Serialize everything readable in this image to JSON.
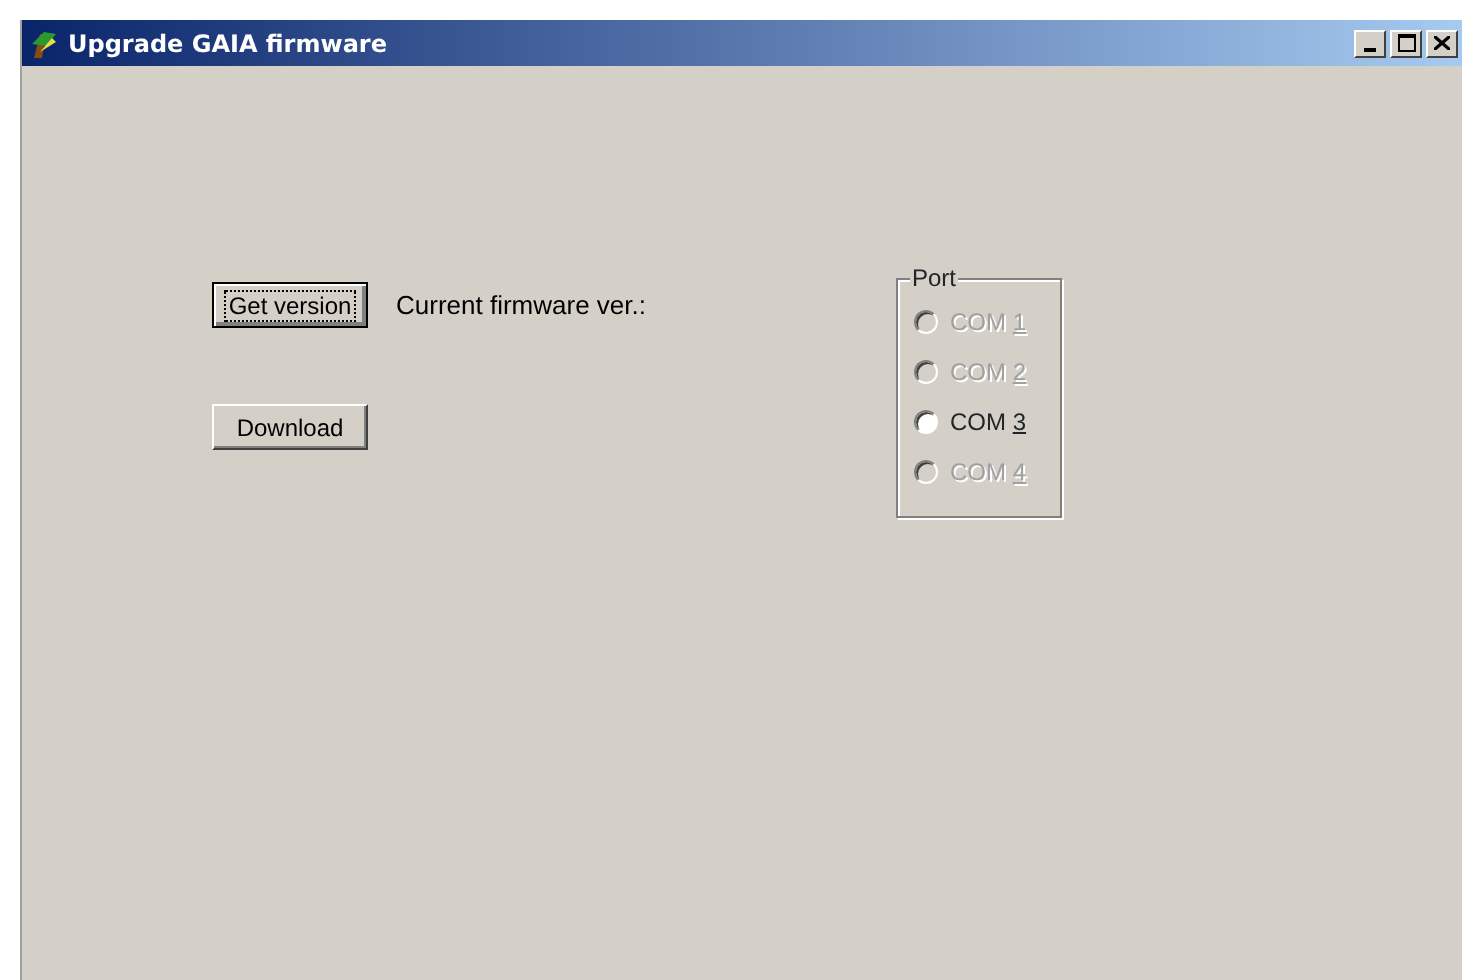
{
  "window": {
    "title": "Upgrade GAIA firmware",
    "controls": [
      {
        "kind": "minimize"
      },
      {
        "kind": "maximize"
      },
      {
        "kind": "close"
      }
    ]
  },
  "buttons": [
    {
      "label": "Get version",
      "focused": true
    },
    {
      "label": "Download",
      "focused": false
    }
  ],
  "firmware_label": "Current firmware ver.:",
  "port_group": {
    "title": "Port",
    "options": [
      {
        "label": "COM 1",
        "disabled": true,
        "selected": false
      },
      {
        "label": "COM 2",
        "disabled": true,
        "selected": false
      },
      {
        "label": "COM 3",
        "disabled": false,
        "selected": false
      },
      {
        "label": "COM 4",
        "disabled": true,
        "selected": false
      }
    ]
  }
}
